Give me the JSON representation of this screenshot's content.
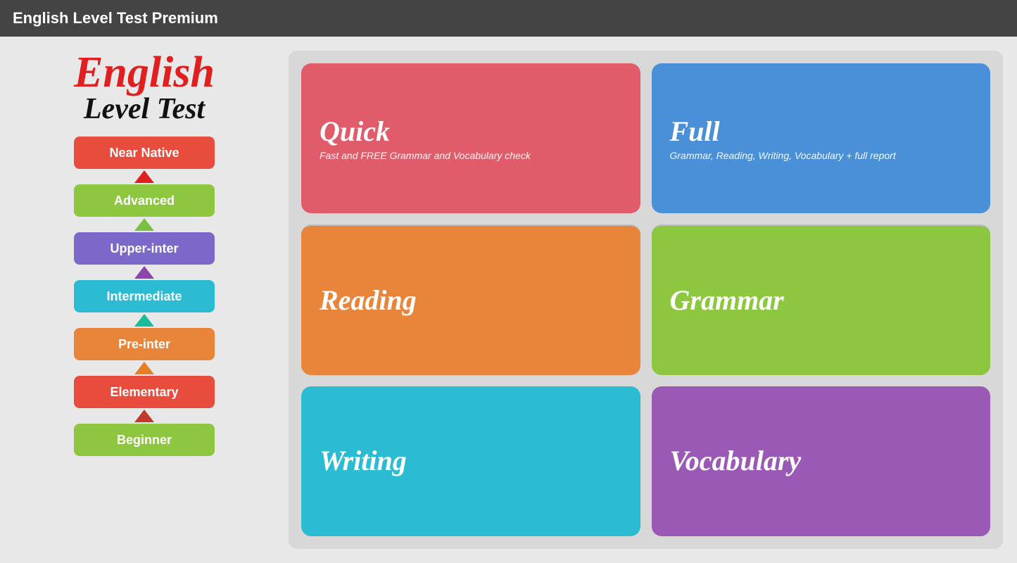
{
  "titleBar": {
    "label": "English Level Test Premium"
  },
  "logo": {
    "english": "English",
    "levelTest": "Level Test"
  },
  "levels": [
    {
      "id": "near-native",
      "label": "Near Native",
      "class": "btn-near-native",
      "arrowClass": ""
    },
    {
      "id": "advanced",
      "label": "Advanced",
      "class": "btn-advanced",
      "arrowClass": "arrow-red"
    },
    {
      "id": "upper-inter",
      "label": "Upper-inter",
      "class": "btn-upper-inter",
      "arrowClass": "arrow-green"
    },
    {
      "id": "intermediate",
      "label": "Intermediate",
      "class": "btn-intermediate",
      "arrowClass": "arrow-purple"
    },
    {
      "id": "pre-inter",
      "label": "Pre-inter",
      "class": "btn-pre-inter",
      "arrowClass": "arrow-teal"
    },
    {
      "id": "elementary",
      "label": "Elementary",
      "class": "btn-elementary",
      "arrowClass": "arrow-orange"
    },
    {
      "id": "beginner",
      "label": "Beginner",
      "class": "btn-beginner",
      "arrowClass": "arrow-darkred"
    }
  ],
  "tests": [
    {
      "id": "quick",
      "title": "Quick",
      "subtitle": "Fast and FREE Grammar and Vocabulary check",
      "class": "btn-quick"
    },
    {
      "id": "full",
      "title": "Full",
      "subtitle": "Grammar, Reading, Writing, Vocabulary + full report",
      "class": "btn-full"
    },
    {
      "id": "reading",
      "title": "Reading",
      "subtitle": "",
      "class": "btn-reading"
    },
    {
      "id": "grammar",
      "title": "Grammar",
      "subtitle": "",
      "class": "btn-grammar"
    },
    {
      "id": "writing",
      "title": "Writing",
      "subtitle": "",
      "class": "btn-writing"
    },
    {
      "id": "vocabulary",
      "title": "Vocabulary",
      "subtitle": "",
      "class": "btn-vocabulary"
    }
  ]
}
